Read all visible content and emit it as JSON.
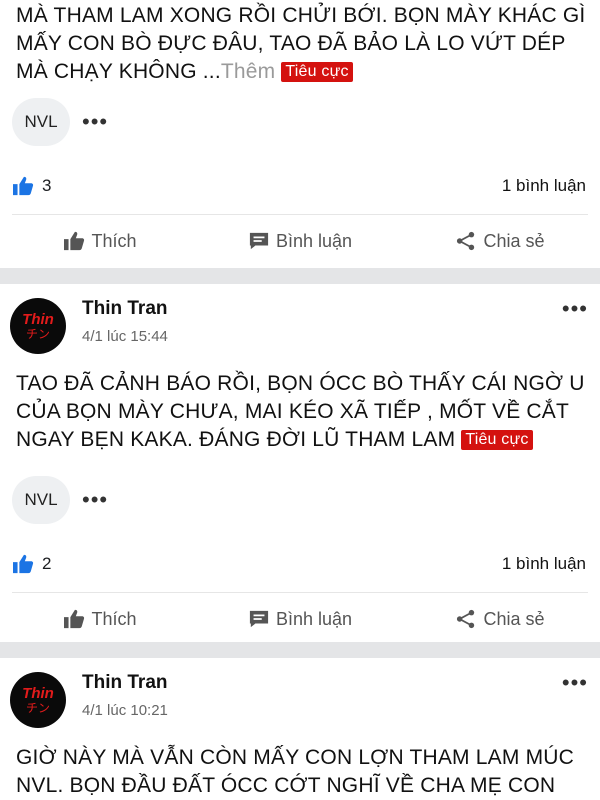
{
  "posts": [
    {
      "text": "MÀ THAM LAM XONG RỒI CHỬI BỚI. BỌN MÀY KHÁC GÌ MẤY CON BÒ ĐỰC ĐÂU, TAO ĐÃ BẢO LÀ LO VỨT DÉP MÀ CHẠY KHÔNG ...",
      "more_label": "Thêm",
      "tag": "Tiêu cực",
      "chip": "NVL",
      "likes": "3",
      "comments": "1 bình luận"
    },
    {
      "author": "Thin Tran",
      "time": "4/1 lúc 15:44",
      "text": "TAO ĐÃ CẢNH BÁO RỒI,  BỌN ÓCC BÒ THẤY CÁI NGỜ U CỦA BỌN MÀY CHƯA,  MAI KÉO XÃ TIẾP , MỐT VỀ CẮT NGAY BẸN KAKA.  ĐÁNG ĐỜI LŨ THAM LAM",
      "tag": "Tiêu cực",
      "chip": "NVL",
      "likes": "2",
      "comments": "1 bình luận"
    },
    {
      "author": "Thin Tran",
      "time": "4/1 lúc 10:21",
      "text": "GIỜ NÀY MÀ VẪN CÒN MẤY CON LỢN THAM LAM MÚC NVL. BỌN ĐẦU ĐẤT ÓCC CỚT NGHĨ VỀ CHA MẸ  CON CÁI"
    }
  ],
  "avatar": {
    "line1": "Thin",
    "line2": "チン"
  },
  "actions": {
    "like": "Thích",
    "comment": "Bình luận",
    "share": "Chia sẻ"
  },
  "colors": {
    "tag_bg": "#d4120f",
    "like_blue": "#1b74e4",
    "separator": "#e4e5e7"
  }
}
